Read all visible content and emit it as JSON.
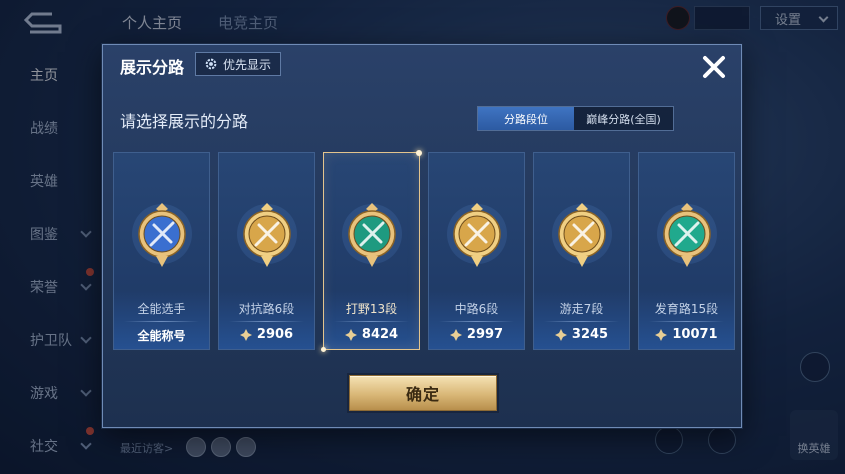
{
  "background": {
    "tabs": [
      "个人主页",
      "电竞主页"
    ],
    "side_nav": [
      "主页",
      "战绩",
      "英雄",
      "图鉴",
      "荣誉",
      "护卫队",
      "游戏",
      "社交"
    ],
    "settings_label": "设置",
    "recent_visitors_label": "最近访客>",
    "right_button_label": "换英雄"
  },
  "modal": {
    "title": "展示分路",
    "priority_button_label": "优先显示",
    "subtitle": "请选择展示的分路",
    "segments": [
      "分路段位",
      "巅峰分路(全国)"
    ],
    "active_segment": 0,
    "confirm_label": "确定",
    "cards": [
      {
        "label": "全能选手",
        "value": "全能称号",
        "badge": "all-round-badge-icon",
        "color": "#3a6fd0",
        "selected": false
      },
      {
        "label": "对抗路6段",
        "value": "2906",
        "badge": "clash-lane-badge-icon",
        "color": "#d8a64a",
        "selected": false
      },
      {
        "label": "打野13段",
        "value": "8424",
        "badge": "jungle-badge-icon",
        "color": "#1e9a80",
        "selected": true
      },
      {
        "label": "中路6段",
        "value": "2997",
        "badge": "mid-lane-badge-icon",
        "color": "#d8a64a",
        "selected": false
      },
      {
        "label": "游走7段",
        "value": "3245",
        "badge": "roam-badge-icon",
        "color": "#d8a64a",
        "selected": false
      },
      {
        "label": "发育路15段",
        "value": "10071",
        "badge": "farm-lane-badge-icon",
        "color": "#20a98d",
        "selected": false
      }
    ]
  }
}
